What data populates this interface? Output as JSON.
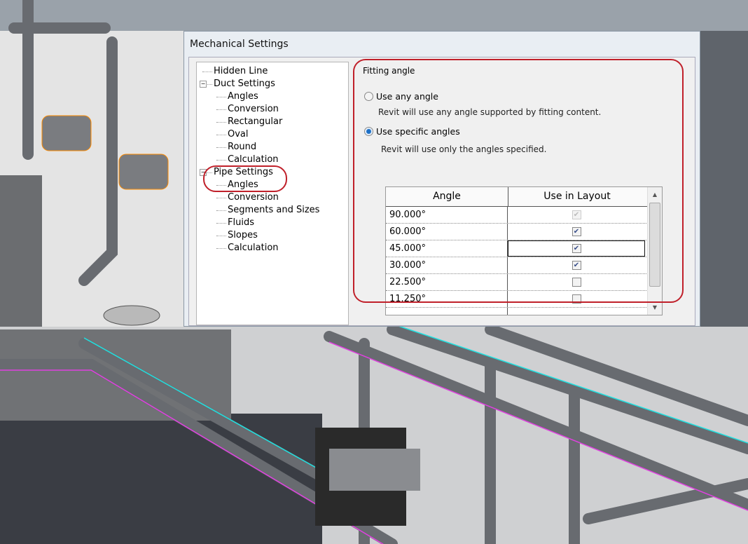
{
  "dialog": {
    "title": "Mechanical Settings"
  },
  "tree": {
    "items": [
      {
        "label": "Hidden Line",
        "level": 0
      },
      {
        "label": "Duct Settings",
        "level": 0,
        "expanded": true
      },
      {
        "label": "Angles",
        "level": 1
      },
      {
        "label": "Conversion",
        "level": 1
      },
      {
        "label": "Rectangular",
        "level": 1
      },
      {
        "label": "Oval",
        "level": 1
      },
      {
        "label": "Round",
        "level": 1
      },
      {
        "label": "Calculation",
        "level": 1
      },
      {
        "label": "Pipe Settings",
        "level": 0,
        "expanded": true
      },
      {
        "label": "Angles",
        "level": 1,
        "selected": true
      },
      {
        "label": "Conversion",
        "level": 1
      },
      {
        "label": "Segments and Sizes",
        "level": 1
      },
      {
        "label": "Fluids",
        "level": 1
      },
      {
        "label": "Slopes",
        "level": 1
      },
      {
        "label": "Calculation",
        "level": 1
      }
    ]
  },
  "panel": {
    "group_label": "Fitting angle",
    "option_any": {
      "label": "Use any angle",
      "desc": "Revit will use any angle supported by fitting content.",
      "selected": false
    },
    "option_specific": {
      "label": "Use specific angles",
      "desc": "Revit will use only the angles specified.",
      "selected": true
    }
  },
  "table": {
    "headers": [
      "Angle",
      "Use in Layout"
    ],
    "rows": [
      {
        "angle": "90.000°",
        "checked": true,
        "disabled": true
      },
      {
        "angle": "60.000°",
        "checked": true
      },
      {
        "angle": "45.000°",
        "checked": true,
        "selected": true
      },
      {
        "angle": "30.000°",
        "checked": true
      },
      {
        "angle": "22.500°",
        "checked": false
      },
      {
        "angle": "11.250°",
        "checked": false
      }
    ]
  },
  "colors": {
    "highlight": "#c0202a",
    "radio": "#1b6fc6"
  }
}
